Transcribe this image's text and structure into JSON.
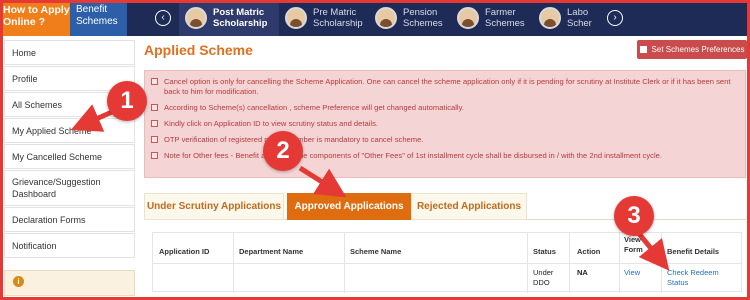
{
  "topbar": {
    "how_to": "How to Apply Online ?",
    "benefit": "Benefit Schemes",
    "prev_icon": "chevron-left-icon",
    "next_icon": "chevron-right-icon",
    "tabs": [
      {
        "label": "Post Matric Scholarship"
      },
      {
        "label": "Pre Matric Scholarship"
      },
      {
        "label": "Pension Schemes"
      },
      {
        "label": "Farmer Schemes"
      },
      {
        "label": "Labo Scher"
      }
    ]
  },
  "sidebar": {
    "items": [
      {
        "label": "Home"
      },
      {
        "label": "Profile"
      },
      {
        "label": "All Schemes"
      },
      {
        "label": "My Applied Scheme"
      },
      {
        "label": "My Cancelled Scheme"
      },
      {
        "label": "Grievance/Suggestion Dashboard"
      },
      {
        "label": "Declaration Forms"
      },
      {
        "label": "Notification"
      }
    ],
    "info_icon": "info-icon"
  },
  "main": {
    "title": "Applied Scheme",
    "pref_button": "Set Schemes Preferences",
    "notes": [
      "Cancel option is only for cancelling the Scheme Application. One can cancel the scheme application only if it is pending for scrutiny at Institute Clerk or if it has been sent back to him for modification.",
      "According to Scheme(s) cancellation , scheme Preference will get changed automatically.",
      "Kindly click on Application ID to view scrutiny status and details.",
      "OTP verification of registered mobile number is mandatory to cancel scheme.",
      "Note for Other fees - Benefit amount of the components of \"Other Fees\" of 1st installment cycle shall be disbursed in / with the 2nd installment cycle."
    ],
    "tabs": [
      {
        "label": "Under Scrutiny Applications"
      },
      {
        "label": "Approved Applications"
      },
      {
        "label": "Rejected Applications"
      }
    ],
    "table": {
      "headers": [
        "Application ID",
        "Department Name",
        "Scheme Name",
        "Status",
        "Action",
        "View Form",
        "Benefit Details"
      ],
      "row": {
        "status": "Under DDO",
        "action": "NA",
        "view_form": "View",
        "benefit": "Check Redeem Status"
      }
    }
  },
  "annotations": {
    "n1": "1",
    "n2": "2",
    "n3": "3",
    "color": "#e53935"
  }
}
